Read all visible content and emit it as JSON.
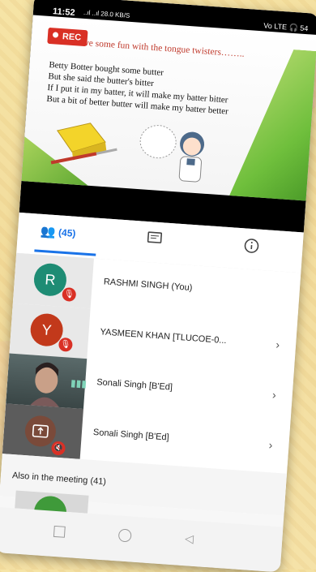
{
  "status": {
    "time": "11:52",
    "signal": "..ıl ..ıl",
    "network": "28.0 KB/S",
    "right": "Vo LTE",
    "battery": "54"
  },
  "recording": {
    "label": "REC"
  },
  "slide": {
    "title": "Let's have some fun with the tongue twisters……..",
    "lines": [
      "Betty Botter bought some butter",
      "But she said the butter's bitter",
      "If I put it in my batter, it will make my batter bitter",
      "But a bit of better butter will make my batter better"
    ]
  },
  "tabs": {
    "people_count": "(45)"
  },
  "participants": [
    {
      "initial": "R",
      "name": "RASHMI SINGH (You)",
      "color": "#1e8c74"
    },
    {
      "initial": "Y",
      "name": "YASMEEN KHAN [TLUCOE-0...",
      "color": "#c2391b"
    },
    {
      "name": "Sonali Singh [B'Ed]"
    },
    {
      "name": "Sonali Singh [B'Ed]"
    }
  ],
  "also_in_meeting": "Also in the meeting (41)",
  "colors": {
    "accent": "#1a73e8",
    "rec": "#d93025",
    "green_slide": "#6fbf3c"
  }
}
